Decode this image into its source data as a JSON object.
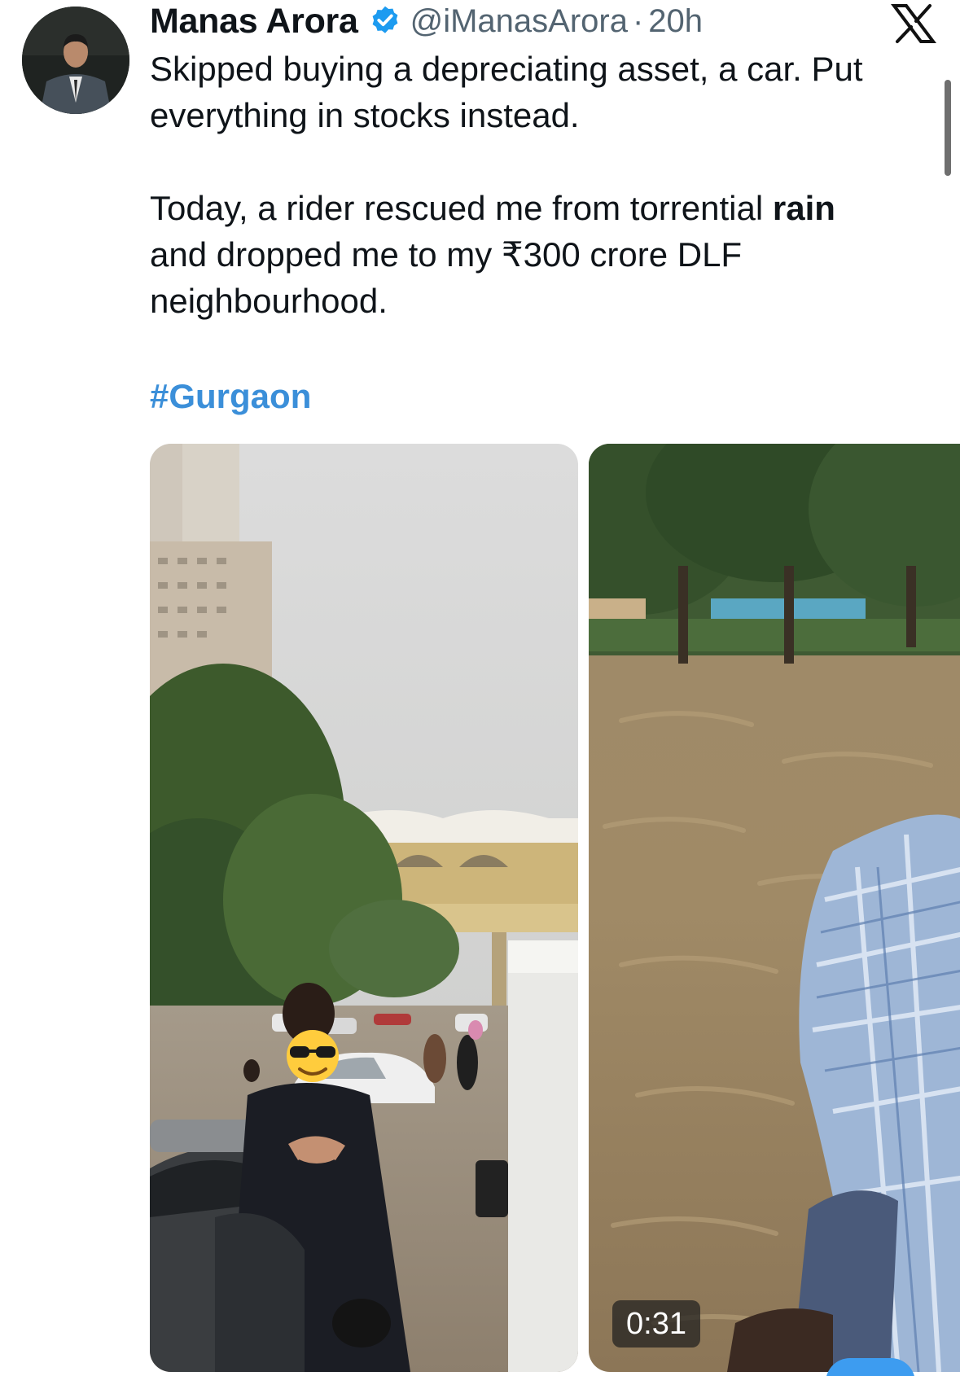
{
  "tweet": {
    "author_name": "Manas Arora",
    "verified": true,
    "handle": "@iManasArora",
    "separator": "·",
    "time": "20h",
    "text": {
      "line1": "Skipped buying a depreciating asset, a car. Put",
      "line2": "everything in stocks instead.",
      "line3_before_bold": "Today, a rider rescued me from torrential ",
      "line3_bold": "rain",
      "line4": "and dropped me to my ₹300 crore DLF",
      "line5": "neighbourhood."
    },
    "hashtag": "#Gurgaon"
  },
  "media": {
    "video_duration": "0:31",
    "items": [
      {
        "kind": "photo",
        "icon": "flooded-street-photo"
      },
      {
        "kind": "video",
        "icon": "flood-ride-video"
      }
    ]
  },
  "icons": {
    "platform": "x-logo-icon",
    "verified": "verified-badge-icon"
  },
  "colors": {
    "text": "#0f1419",
    "secondary": "#536471",
    "hashtag": "#3b8fd9",
    "verified": "#1d9bf0"
  }
}
